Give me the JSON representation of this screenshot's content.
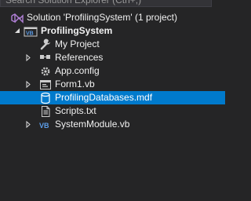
{
  "search": {
    "placeholder": "Search Solution Explorer (Ctrl+;)"
  },
  "tree": {
    "solution": {
      "label": "Solution 'ProfilingSystem' (1 project)",
      "icon": "solution-icon"
    },
    "project": {
      "label": "ProfilingSystem",
      "icon": "vb-project-icon",
      "expanded": true
    },
    "items": [
      {
        "label": "My Project",
        "icon": "wrench-icon",
        "expandable": false
      },
      {
        "label": "References",
        "icon": "references-icon",
        "expandable": true
      },
      {
        "label": "App.config",
        "icon": "config-icon",
        "expandable": false
      },
      {
        "label": "Form1.vb",
        "icon": "form-icon",
        "expandable": true
      },
      {
        "label": "ProfilingDatabases.mdf",
        "icon": "database-icon",
        "expandable": false,
        "selected": true
      },
      {
        "label": "Scripts.txt",
        "icon": "text-file-icon",
        "expandable": false
      },
      {
        "label": "SystemModule.vb",
        "icon": "vb-file-icon",
        "expandable": true
      }
    ]
  },
  "colors": {
    "background": "#252526",
    "selection": "#007acc",
    "text": "#f1f1f1",
    "vb_accent": "#5c9de8",
    "solution_accent": "#b180d7"
  }
}
